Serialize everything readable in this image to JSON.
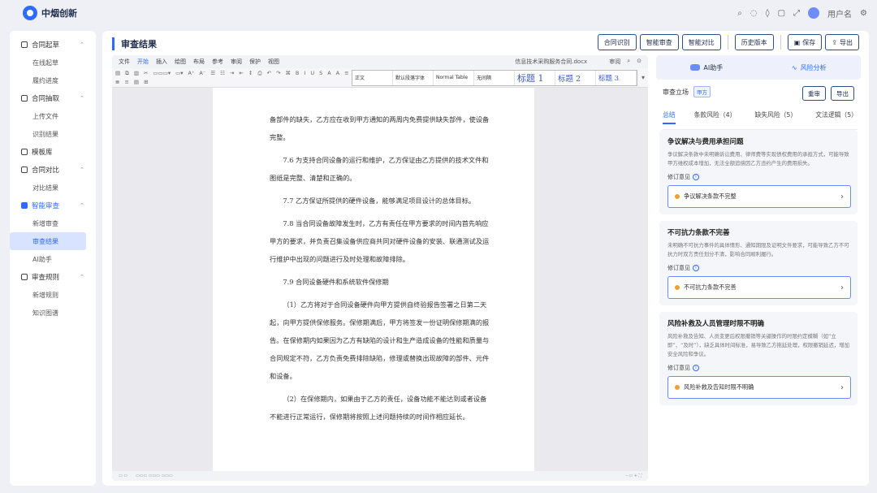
{
  "app": {
    "name": "中烟创新",
    "user": "用户名"
  },
  "sidebar": {
    "groups": [
      {
        "label": "合同起草",
        "items": [
          "在线起草",
          "履约进度"
        ]
      },
      {
        "label": "合同抽取",
        "items": [
          "上传文件",
          "识别结果"
        ]
      },
      {
        "label": "模板库",
        "items": []
      },
      {
        "label": "合同对比",
        "items": [
          "对比结果"
        ]
      },
      {
        "label": "智能审查",
        "items": [
          "新增审查",
          "审查结果",
          "AI助手"
        ]
      },
      {
        "label": "审查规则",
        "items": [
          "新增规则",
          "知识图谱"
        ]
      }
    ]
  },
  "page": {
    "title": "审查结果"
  },
  "actions": {
    "recognize": "合同识别",
    "smart_review": "智能审查",
    "smart_compare": "智能对比",
    "history": "历史版本",
    "save": "保存",
    "export": "导出"
  },
  "editor": {
    "menu": [
      "文件",
      "开始",
      "插入",
      "绘图",
      "布局",
      "参考",
      "审阅",
      "保护",
      "视图"
    ],
    "active_menu": "开始",
    "doc_name": "信息技术采购服务合同.docx",
    "review_menu": "审阅",
    "styles": [
      "正文",
      "默认段落字体",
      "Normal Table",
      "无间隔",
      "标题 1",
      "标题 2",
      "标题 3"
    ],
    "paragraphs": [
      {
        "text": "备部件的缺失，乙方应在收到甲方通知的两周内免费提供缺失部件，使设备完整。",
        "nm": true
      },
      {
        "text": "7.6 为支持合同设备的运行和维护，乙方保证由乙方提供的技术文件和图纸是完整、清楚和正确的。",
        "nm": false
      },
      {
        "text": "7.7 乙方保证所提供的硬件设备，能够满足项目设计的总体目标。",
        "nm": false
      },
      {
        "text": "7.8 当合同设备故障发生时，乙方有责任在甲方要求的时间内首先响应甲方的要求，并负责召集设备供应商共同对硬件设备的安装、联通测试及运行维护中出现的问题进行及时处理和故障排除。",
        "nm": false
      },
      {
        "text": "7.9 合同设备硬件和系统软件保修期",
        "nm": false
      },
      {
        "text": "（1）乙方将对于合同设备硬件向甲方提供自终验报告签署之日第二天起，向甲方提供保修服务。保修期满后，甲方将签发一份证明保修期满的报告。在保修期内如果因为乙方有缺陷的设计和生产造成设备的性能和质量与合同规定不符，乙方负责免费排除缺陷，修理或替换出现故障的部件、元件和设备。",
        "nm": false
      },
      {
        "text": "（2）在保修期内，如果由于乙方的责任，设备功能不能达到或者设备不能进行正常运行，保修期将按照上述问题持续的时间作相应延长。",
        "nm": false
      }
    ]
  },
  "panel": {
    "tab_ai": "AI助手",
    "tab_risk": "风险分析",
    "stand_label": "审查立场",
    "stand_value": "甲方",
    "rebtn": "重审",
    "export": "导出",
    "subtabs": [
      "总结",
      "条款风险（4）",
      "缺失风险（5）",
      "文法逻辑（5）"
    ],
    "opinion_label": "修订意见",
    "cards": [
      {
        "title": "争议解决与费用承担问题",
        "desc": "争议解决条款中未明确诉讼费用、律师费等实现债权费用的承担方式，可能导致甲方维权成本增加，无法全额追偿因乙方违约产生的费用损失。",
        "opinion": "争议解决条款不完整"
      },
      {
        "title": "不可抗力条款不完善",
        "desc": "未明确不可抗力事件的具体情形、通知期限及证明文件要求，可能导致乙方不可抗力时双方责任划分不清，影响合同顺利履行。",
        "opinion": "不可抗力条款不完善"
      },
      {
        "title": "风险补救及人员管理时限不明确",
        "desc": "风险补救及告知、人员变更后权限撤销等关键操作的时限约定模糊（如“立即”、“及时”），缺乏具体时间标准，易导致乙方拖延处理，权限撤销延迟，增加安全风险和争议。",
        "opinion": "风险补救及告知时限不明确"
      }
    ]
  }
}
